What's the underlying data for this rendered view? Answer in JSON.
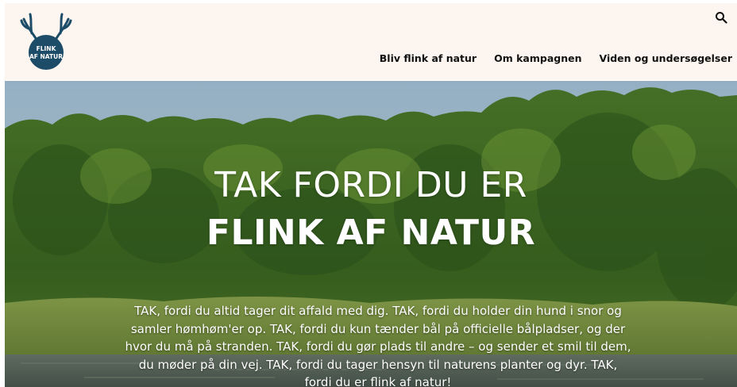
{
  "brand": {
    "logo_line1": "FLINK",
    "logo_line2": "AF NATUR",
    "logo_color": "#1d4c69"
  },
  "header": {
    "search_icon": "search-icon",
    "nav": [
      {
        "label": "Bliv flink af natur"
      },
      {
        "label": "Om kampagnen"
      },
      {
        "label": "Viden og undersøgelser"
      }
    ]
  },
  "hero": {
    "title_line1": "TAK FORDI DU ER",
    "title_line2": "FLINK AF NATUR",
    "body": "TAK, fordi du altid tager dit affald med dig. TAK, fordi du holder din hund i snor og samler hømhøm'er op. TAK, fordi du kun tænder bål på officielle bålpladser, og der hvor du må på stranden. TAK, fordi du gør plads til andre – og sender et smil til dem, du møder på din vej. TAK, fordi du tager hensyn til naturens planter og dyr. TAK, fordi du er flink af natur!"
  },
  "colors": {
    "header_bg": "#fdf6f0",
    "sky": "#b9d3e6",
    "forest_dark": "#2f5a1e",
    "forest_light": "#79a63a",
    "water": "#5c6b62"
  }
}
